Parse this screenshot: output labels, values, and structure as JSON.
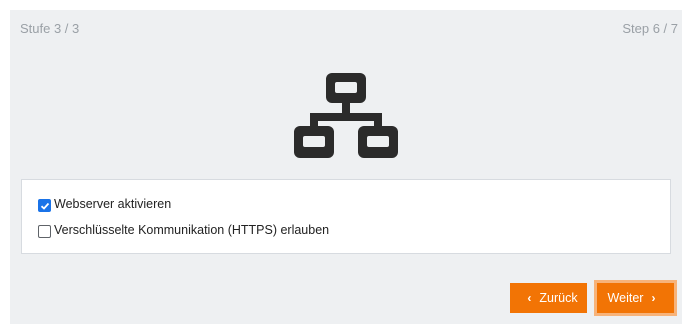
{
  "header": {
    "stage_label": "Stufe 3 / 3",
    "step_label": "Step 6 / 7"
  },
  "hero": {
    "icon": "network-icon"
  },
  "options": [
    {
      "label": "Webserver aktivieren",
      "checked": true
    },
    {
      "label": "Verschlüsselte Kommunikation (HTTPS) erlauben",
      "checked": false
    }
  ],
  "footer": {
    "back_label": "Zurück",
    "next_label": "Weiter"
  },
  "colors": {
    "accent": "#f27405",
    "checkbox": "#1a73e8",
    "panel_bg": "#eef0f2"
  }
}
